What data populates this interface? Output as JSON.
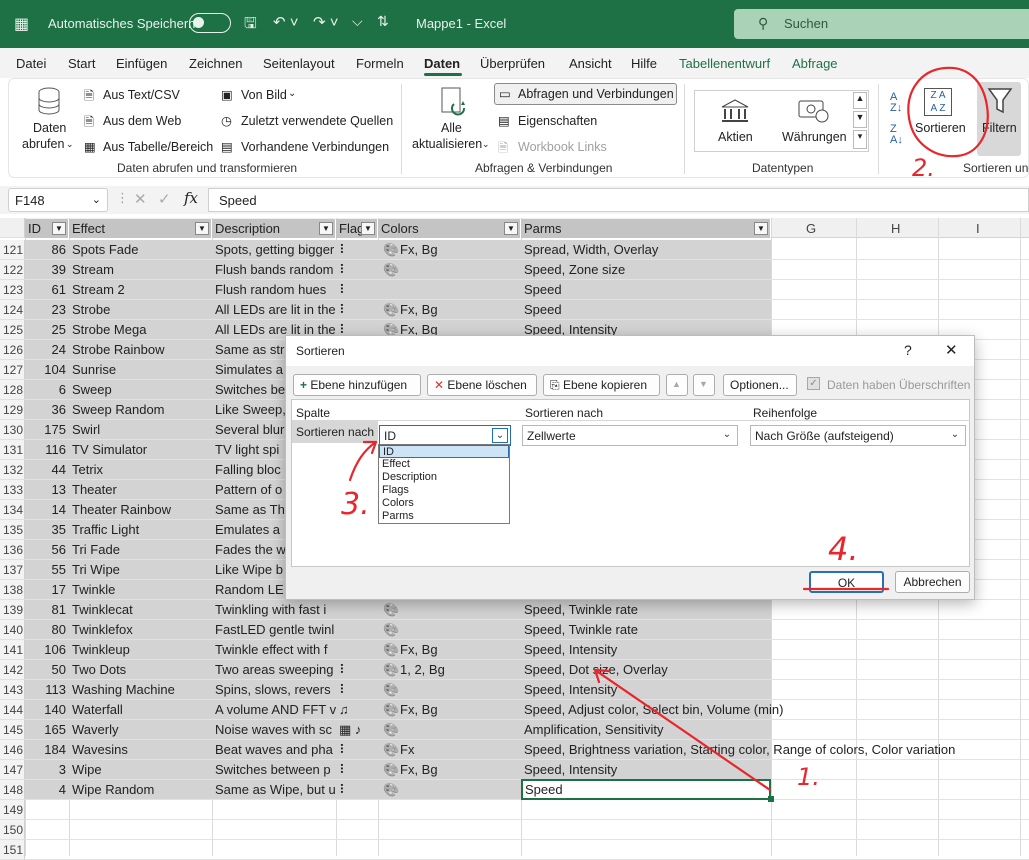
{
  "titlebar": {
    "autosave_label": "Automatisches Speichern",
    "document_title": "Mappe1  -  Excel",
    "search_placeholder": "Suchen"
  },
  "menu": {
    "tabs": [
      "Datei",
      "Start",
      "Einfügen",
      "Zeichnen",
      "Seitenlayout",
      "Formeln",
      "Daten",
      "Überprüfen",
      "Ansicht",
      "Hilfe",
      "Tabellenentwurf",
      "Abfrage"
    ],
    "active": "Daten"
  },
  "ribbon": {
    "daten_abrufen_line1": "Daten",
    "daten_abrufen_line2": "abrufen",
    "aus_text_csv": "Aus Text/CSV",
    "aus_dem_web": "Aus dem Web",
    "aus_tabelle": "Aus Tabelle/Bereich",
    "von_bild": "Von Bild",
    "zuletzt": "Zuletzt verwendete Quellen",
    "vorhandene": "Vorhandene Verbindungen",
    "group1": "Daten abrufen und transformieren",
    "alle_line1": "Alle",
    "alle_line2": "aktualisieren",
    "abfragen_verbindungen": "Abfragen und Verbindungen",
    "eigenschaften": "Eigenschaften",
    "workbook_links": "Workbook Links",
    "group2": "Abfragen & Verbindungen",
    "aktien": "Aktien",
    "waehrungen": "Währungen",
    "group3": "Datentypen",
    "sortieren": "Sortieren",
    "filter": "Filtern",
    "group4": "Sortieren und"
  },
  "formula_bar": {
    "name_box": "F148",
    "fx": "fx",
    "value": "Speed"
  },
  "grid": {
    "column_letters": [
      "G",
      "H",
      "I"
    ],
    "headers": [
      "ID",
      "Effect",
      "Description",
      "Flag",
      "Colors",
      "Parms"
    ],
    "rows": [
      {
        "n": "121",
        "id": "86",
        "effect": "Spots Fade",
        "desc": "Spots, getting bigger",
        "flag": "⠇",
        "colors": "Fx, Bg",
        "parms": "Spread, Width, Overlay",
        "palette": true
      },
      {
        "n": "122",
        "id": "39",
        "effect": "Stream",
        "desc": "Flush bands random",
        "flag": "⠇",
        "colors": "",
        "parms": "Speed, Zone size",
        "palette": true
      },
      {
        "n": "123",
        "id": "61",
        "effect": "Stream 2",
        "desc": "Flush random hues",
        "flag": "⠇",
        "colors": "",
        "parms": "Speed",
        "palette": false
      },
      {
        "n": "124",
        "id": "23",
        "effect": "Strobe",
        "desc": "All LEDs are lit in the",
        "flag": "⠇",
        "colors": "Fx, Bg",
        "parms": "Speed",
        "palette": true
      },
      {
        "n": "125",
        "id": "25",
        "effect": "Strobe Mega",
        "desc": "All LEDs are lit in the",
        "flag": "⠇",
        "colors": "Fx, Bg",
        "parms": "Speed, Intensity",
        "palette": true
      },
      {
        "n": "126",
        "id": "24",
        "effect": "Strobe Rainbow",
        "desc": "Same as str",
        "flag": "",
        "colors": "",
        "parms": "",
        "palette": false
      },
      {
        "n": "127",
        "id": "104",
        "effect": "Sunrise",
        "desc": "Simulates a",
        "flag": "",
        "colors": "",
        "parms": "",
        "palette": false
      },
      {
        "n": "128",
        "id": "6",
        "effect": "Sweep",
        "desc": "Switches be",
        "flag": "",
        "colors": "",
        "parms": "",
        "palette": false
      },
      {
        "n": "129",
        "id": "36",
        "effect": "Sweep Random",
        "desc": "Like Sweep,",
        "flag": "",
        "colors": "",
        "parms": "",
        "palette": false
      },
      {
        "n": "130",
        "id": "175",
        "effect": "Swirl",
        "desc": "Several blur",
        "flag": "",
        "colors": "",
        "parms": "",
        "palette": false
      },
      {
        "n": "131",
        "id": "116",
        "effect": "TV Simulator",
        "desc": "TV light spi",
        "flag": "",
        "colors": "",
        "parms": "",
        "palette": false
      },
      {
        "n": "132",
        "id": "44",
        "effect": "Tetrix",
        "desc": "Falling bloc",
        "flag": "",
        "colors": "",
        "parms": "",
        "palette": false
      },
      {
        "n": "133",
        "id": "13",
        "effect": "Theater",
        "desc": "Pattern of o",
        "flag": "",
        "colors": "",
        "parms": "",
        "palette": false
      },
      {
        "n": "134",
        "id": "14",
        "effect": "Theater Rainbow",
        "desc": "Same as Th",
        "flag": "",
        "colors": "",
        "parms": "",
        "palette": false
      },
      {
        "n": "135",
        "id": "35",
        "effect": "Traffic Light",
        "desc": "Emulates a",
        "flag": "",
        "colors": "",
        "parms": "",
        "palette": false
      },
      {
        "n": "136",
        "id": "56",
        "effect": "Tri Fade",
        "desc": "Fades the w",
        "flag": "",
        "colors": "",
        "parms": "",
        "palette": false
      },
      {
        "n": "137",
        "id": "55",
        "effect": "Tri Wipe",
        "desc": "Like Wipe b",
        "flag": "",
        "colors": "",
        "parms": "",
        "palette": false
      },
      {
        "n": "138",
        "id": "17",
        "effect": "Twinkle",
        "desc": "Random LE",
        "flag": "",
        "colors": "",
        "parms": "",
        "palette": false
      },
      {
        "n": "139",
        "id": "81",
        "effect": "Twinklecat",
        "desc": "Twinkling with fast i",
        "flag": "",
        "colors": "",
        "parms": "Speed, Twinkle rate",
        "palette": true
      },
      {
        "n": "140",
        "id": "80",
        "effect": "Twinklefox",
        "desc": "FastLED gentle twinl",
        "flag": "",
        "colors": "",
        "parms": "Speed, Twinkle rate",
        "palette": true
      },
      {
        "n": "141",
        "id": "106",
        "effect": "Twinkleup",
        "desc": "Twinkle effect with f",
        "flag": "",
        "colors": "Fx, Bg",
        "parms": "Speed, Intensity",
        "palette": true
      },
      {
        "n": "142",
        "id": "50",
        "effect": "Two Dots",
        "desc": "Two areas sweeping",
        "flag": "⠇",
        "colors": "1, 2, Bg",
        "parms": "Speed, Dot size, Overlay",
        "palette": true
      },
      {
        "n": "143",
        "id": "113",
        "effect": "Washing Machine",
        "desc": "Spins, slows, revers",
        "flag": "⠇",
        "colors": "",
        "parms": "Speed, Intensity",
        "palette": true
      },
      {
        "n": "144",
        "id": "140",
        "effect": "Waterfall",
        "desc": "A volume AND FFT v",
        "flag": "♫",
        "colors": "Fx, Bg",
        "parms": "Speed, Adjust color, Select bin, Volume (min)",
        "palette": true
      },
      {
        "n": "145",
        "id": "165",
        "effect": "Waverly",
        "desc": "Noise waves with sc",
        "flag": "▦ ♪",
        "colors": "",
        "parms": "Amplification, Sensitivity",
        "palette": true
      },
      {
        "n": "146",
        "id": "184",
        "effect": "Wavesins",
        "desc": "Beat waves and pha",
        "flag": "⠇",
        "colors": "Fx",
        "parms": "Speed, Brightness variation, Starting color, Range of colors, Color variation",
        "palette": true
      },
      {
        "n": "147",
        "id": "3",
        "effect": "Wipe",
        "desc": "Switches between p",
        "flag": "⠇",
        "colors": "Fx, Bg",
        "parms": "Speed, Intensity",
        "palette": true
      },
      {
        "n": "148",
        "id": "4",
        "effect": "Wipe Random",
        "desc": "Same as Wipe, but u",
        "flag": "⠇",
        "colors": "",
        "parms": "Speed",
        "palette": true
      }
    ],
    "empty_rows": [
      "149",
      "150",
      "151"
    ]
  },
  "dialog": {
    "title": "Sortieren",
    "help": "?",
    "close": "✕",
    "add_level": "Ebene hinzufügen",
    "delete_level": "Ebene löschen",
    "copy_level": "Ebene kopieren",
    "up": "▲",
    "down": "▼",
    "options": "Optionen...",
    "has_headers": "Daten haben Überschriften",
    "col_spalte": "Spalte",
    "col_sortieren_nach": "Sortieren nach",
    "col_reihenfolge": "Reihenfolge",
    "row_label": "Sortieren nach",
    "column_value": "ID",
    "sort_on_value": "Zellwerte",
    "order_value": "Nach Größe (aufsteigend)",
    "dropdown_options": [
      "ID",
      "Effect",
      "Description",
      "Flags",
      "Colors",
      "Parms"
    ],
    "ok": "OK",
    "cancel": "Abbrechen"
  },
  "annotations": [
    "1.",
    "2.",
    "3.",
    "4."
  ],
  "colors": {
    "excel_green": "#1e7145",
    "annotation_red": "#e8262b",
    "selection_gray": "#d3d3d3"
  }
}
